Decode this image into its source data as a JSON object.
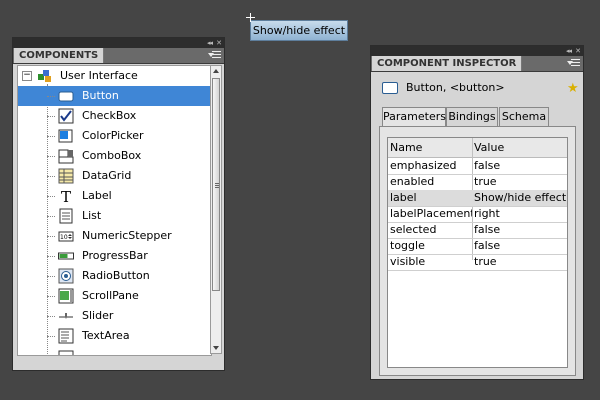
{
  "stage": {
    "button_label": "Show/hide effect"
  },
  "components_panel": {
    "title": "COMPONENTS",
    "root_label": "User Interface",
    "items": [
      {
        "label": "Button",
        "icon": "button-icon"
      },
      {
        "label": "CheckBox",
        "icon": "checkbox-icon"
      },
      {
        "label": "ColorPicker",
        "icon": "colorpicker-icon"
      },
      {
        "label": "ComboBox",
        "icon": "combobox-icon"
      },
      {
        "label": "DataGrid",
        "icon": "datagrid-icon"
      },
      {
        "label": "Label",
        "icon": "label-icon"
      },
      {
        "label": "List",
        "icon": "list-icon"
      },
      {
        "label": "NumericStepper",
        "icon": "numericstepper-icon"
      },
      {
        "label": "ProgressBar",
        "icon": "progressbar-icon"
      },
      {
        "label": "RadioButton",
        "icon": "radiobutton-icon"
      },
      {
        "label": "ScrollPane",
        "icon": "scrollpane-icon"
      },
      {
        "label": "Slider",
        "icon": "slider-icon"
      },
      {
        "label": "TextArea",
        "icon": "textarea-icon"
      }
    ],
    "selected_item": "Button",
    "collapse_glyph": "◂◂",
    "close_glyph": "✕"
  },
  "inspector": {
    "title": "COMPONENT INSPECTOR",
    "component_name": "Button, <button>",
    "tabs": {
      "parameters": "Parameters",
      "bindings": "Bindings",
      "schema": "Schema"
    },
    "active_tab": "Parameters",
    "columns": {
      "name": "Name",
      "value": "Value"
    },
    "rows": [
      {
        "name": "emphasized",
        "value": "false"
      },
      {
        "name": "enabled",
        "value": "true"
      },
      {
        "name": "label",
        "value": "Show/hide effect"
      },
      {
        "name": "labelPlacement",
        "value": "right"
      },
      {
        "name": "selected",
        "value": "false"
      },
      {
        "name": "toggle",
        "value": "false"
      },
      {
        "name": "visible",
        "value": "true"
      }
    ],
    "selected_row": "label",
    "collapse_glyph": "◂◂",
    "close_glyph": "✕"
  },
  "colors": {
    "background": "#454545",
    "selection": "#3f86d6",
    "panel": "#d5d5d5"
  }
}
